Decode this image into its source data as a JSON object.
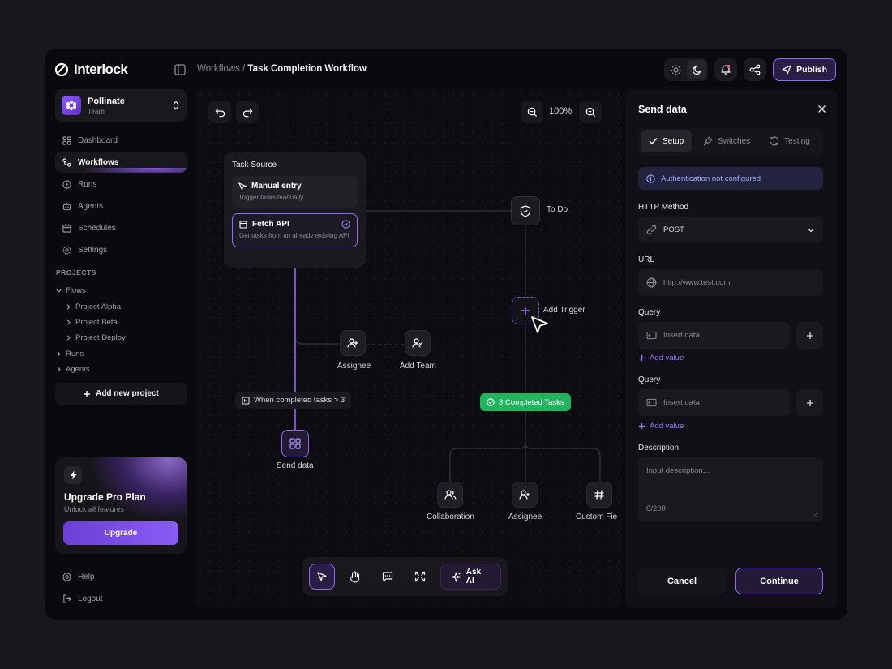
{
  "app": {
    "name": "Interlock"
  },
  "breadcrumb": {
    "parent": "Workflows",
    "separator": " / ",
    "current": "Task Completion Workflow"
  },
  "header": {
    "publish_label": "Publish",
    "theme_mode": "dark"
  },
  "team": {
    "name": "Pollinate",
    "type": "Team"
  },
  "nav": [
    {
      "label": "Dashboard",
      "icon": "grid-icon",
      "active": false
    },
    {
      "label": "Workflows",
      "icon": "workflow-icon",
      "active": true
    },
    {
      "label": "Runs",
      "icon": "play-circle-icon",
      "active": false
    },
    {
      "label": "Agents",
      "icon": "bot-icon",
      "active": false
    },
    {
      "label": "Schedules",
      "icon": "calendar-icon",
      "active": false
    },
    {
      "label": "Settings",
      "icon": "gear-icon",
      "active": false
    }
  ],
  "projects": {
    "heading": "PROJECTS",
    "tree": [
      {
        "label": "Flows",
        "expanded": true
      },
      {
        "label": "Project Alpha"
      },
      {
        "label": "Project Beta"
      },
      {
        "label": "Project Deploy"
      },
      {
        "label": "Runs"
      },
      {
        "label": "Agents"
      }
    ],
    "add_label": "Add new project"
  },
  "upgrade": {
    "title": "Upgrade Pro Plan",
    "subtitle": "Unlock all features",
    "button": "Upgrade"
  },
  "footer_nav": [
    {
      "label": "Help"
    },
    {
      "label": "Logout"
    }
  ],
  "canvas": {
    "zoom": "100%",
    "task_source": {
      "title": "Task Source",
      "options": [
        {
          "title": "Manual entry",
          "desc": "Trigger tasks manually",
          "selected": false
        },
        {
          "title": "Fetch API",
          "desc": "Get tasks from an already existing API",
          "selected": true
        }
      ]
    },
    "nodes": {
      "todo": "To Do",
      "add_trigger": "Add Trigger",
      "assignee": "Assignee",
      "add_team": "Add Team",
      "condition": "When completed tasks > 3",
      "send_data": "Send data",
      "completed": "3 Completed Tasks",
      "collaboration": "Collaboration",
      "assignee2": "Assignee",
      "custom_field": "Custom Fie"
    },
    "toolbar": {
      "ask_ai": "Ask AI"
    }
  },
  "panel": {
    "title": "Send data",
    "tabs": [
      {
        "label": "Setup",
        "active": true
      },
      {
        "label": "Switches"
      },
      {
        "label": "Testing"
      }
    ],
    "alert": "Authentication not configured",
    "http_method": {
      "label": "HTTP Method",
      "value": "POST"
    },
    "url": {
      "label": "URL",
      "placeholder": "http://www.test.com"
    },
    "query1": {
      "label": "Query",
      "placeholder": "Insert data",
      "add_label": "Add value"
    },
    "query2": {
      "label": "Query",
      "placeholder": "Insert data",
      "add_label": "Add value"
    },
    "description": {
      "label": "Description",
      "placeholder": "Input description...",
      "count": "0/200"
    },
    "cancel": "Cancel",
    "continue": "Continue"
  },
  "colors": {
    "accent": "#8f69ff",
    "success": "#22b35e",
    "background": "#0a090d"
  }
}
